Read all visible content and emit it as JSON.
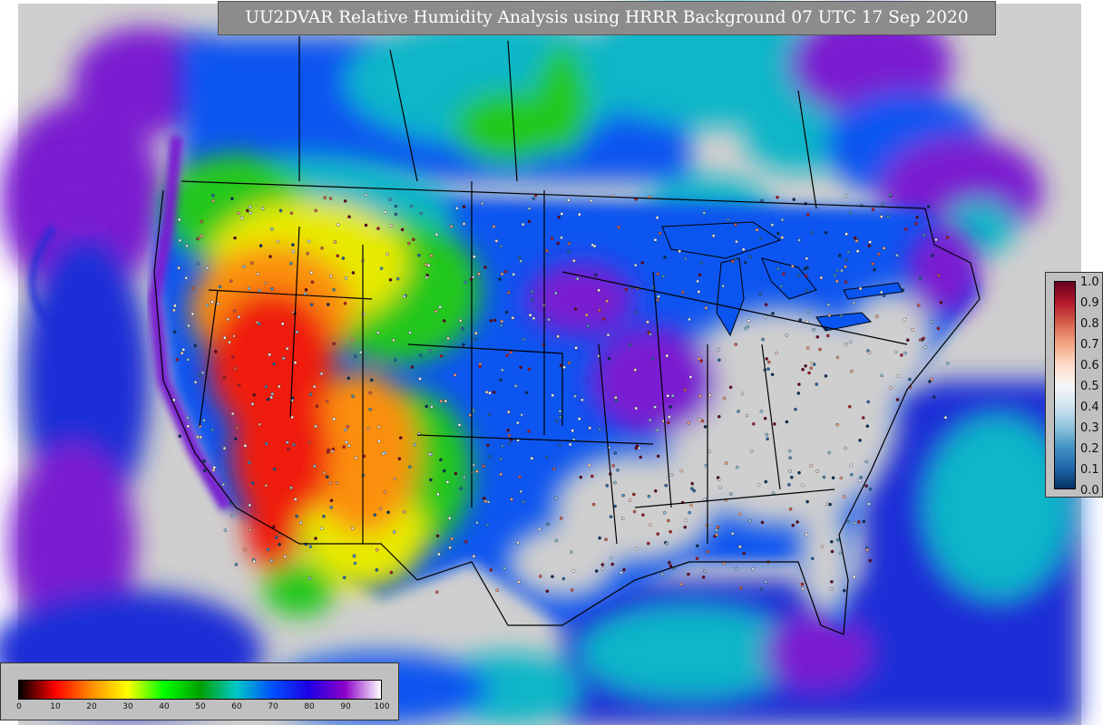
{
  "title": "UU2DVAR Relative Humidity Analysis using HRRR Background 07 UTC 17 Sep 2020",
  "fraction_colorbar": {
    "labels": [
      "1.0",
      "0.9",
      "0.8",
      "0.7",
      "0.6",
      "0.5",
      "0.4",
      "0.3",
      "0.2",
      "0.1",
      "0.0"
    ],
    "colors": [
      "#67001f",
      "#b2182b",
      "#d6604d",
      "#f4a582",
      "#fddbc7",
      "#f7f7f7",
      "#d1e5f0",
      "#92c5de",
      "#4393c3",
      "#2166ac",
      "#053061"
    ]
  },
  "rh_colorbar": {
    "labels": [
      "0",
      "10",
      "20",
      "30",
      "40",
      "50",
      "60",
      "70",
      "80",
      "90",
      "100"
    ],
    "colors": [
      "#000000",
      "#ff0000",
      "#ff8c00",
      "#ffff00",
      "#00ff00",
      "#00a000",
      "#00c8c8",
      "#0050ff",
      "#1e00e6",
      "#8c00c8",
      "#ffffff"
    ]
  },
  "map_colors": {
    "background": "#cfcfcf",
    "ocean": "#1c2fd6",
    "moist": "#7a1fd0",
    "dry_red": "#ef1a0c",
    "dry_orange": "#fb8f08",
    "dry_yellow": "#e7ea05",
    "green": "#22c81e",
    "cyan": "#10b6c8",
    "blue": "#0a55f0",
    "border": "#000000"
  }
}
